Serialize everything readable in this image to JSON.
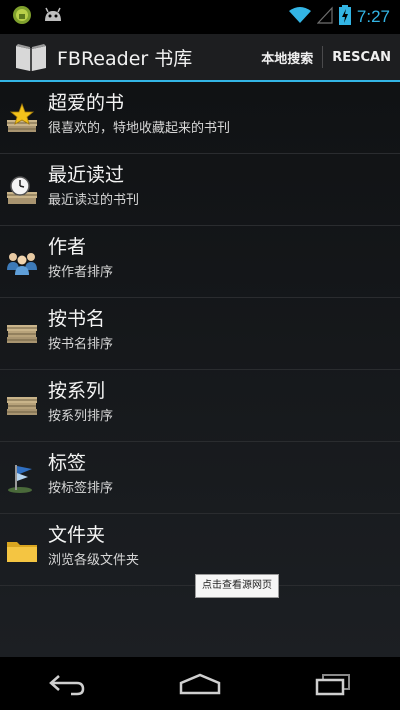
{
  "status_bar": {
    "time": "7:27",
    "icons": [
      "android-robot-icon",
      "bug-icon",
      "wifi-icon",
      "signal-icon",
      "battery-charging-icon"
    ]
  },
  "action_bar": {
    "app_icon": "book-icon",
    "title": "FBReader 书库",
    "actions": [
      {
        "label": "本地搜索"
      },
      {
        "label": "RESCAN"
      }
    ]
  },
  "library": {
    "items": [
      {
        "icon": "favorites-star-icon",
        "title": "超爱的书",
        "subtitle": "很喜欢的，特地收藏起来的书刊"
      },
      {
        "icon": "recent-clock-icon",
        "title": "最近读过",
        "subtitle": "最近读过的书刊"
      },
      {
        "icon": "authors-people-icon",
        "title": "作者",
        "subtitle": "按作者排序"
      },
      {
        "icon": "books-stack-icon",
        "title": "按书名",
        "subtitle": "按书名排序"
      },
      {
        "icon": "books-stack-icon",
        "title": "按系列",
        "subtitle": "按系列排序"
      },
      {
        "icon": "tag-flag-icon",
        "title": "标签",
        "subtitle": "按标签排序"
      },
      {
        "icon": "folder-icon",
        "title": "文件夹",
        "subtitle": "浏览各级文件夹"
      }
    ]
  },
  "tooltip": {
    "text": "点击查看源网页"
  },
  "nav_bar": {
    "buttons": [
      "back-icon",
      "home-icon",
      "recent-apps-icon"
    ]
  },
  "colors": {
    "accent": "#33b5e5",
    "background": "#0b0b0c",
    "action_bar": "#1d1e20"
  }
}
